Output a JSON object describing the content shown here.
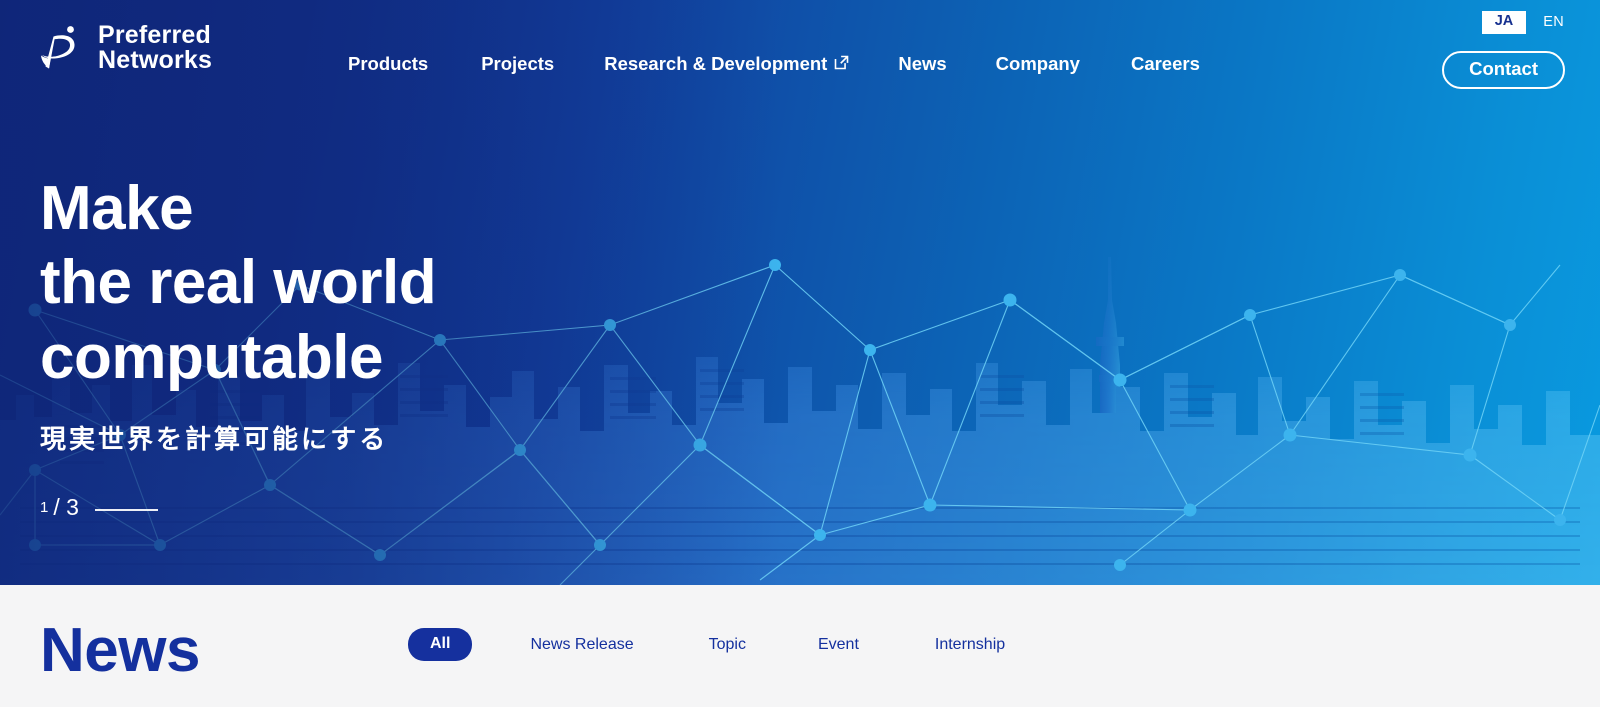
{
  "brand": {
    "logo_line1": "Preferred",
    "logo_line2": "Networks",
    "logo_icon": "preferred-networks-swoosh-logo"
  },
  "nav": {
    "items": [
      {
        "label": "Products",
        "external": false,
        "icon": ""
      },
      {
        "label": "Projects",
        "external": false,
        "icon": ""
      },
      {
        "label": "Research & Development",
        "external": true,
        "icon": "external-link-icon"
      },
      {
        "label": "News",
        "external": false,
        "icon": ""
      },
      {
        "label": "Company",
        "external": false,
        "icon": ""
      },
      {
        "label": "Careers",
        "external": false,
        "icon": ""
      }
    ],
    "contact_label": "Contact"
  },
  "language": {
    "options": [
      "JA",
      "EN"
    ],
    "ja_label": "JA",
    "en_label": "EN",
    "selected": "JA"
  },
  "hero": {
    "title": "Make\nthe real world\ncomputable",
    "subtitle": "現実世界を計算可能にする",
    "slide_current": "1",
    "slide_total": "/ 3",
    "background_image": "tokyo-skyline-network-overlay"
  },
  "news": {
    "heading": "News",
    "filters": [
      {
        "label": "All",
        "active": true
      },
      {
        "label": "News Release",
        "active": false
      },
      {
        "label": "Topic",
        "active": false
      },
      {
        "label": "Event",
        "active": false
      },
      {
        "label": "Internship",
        "active": false
      }
    ]
  },
  "colors": {
    "brand_navy": "#14309e",
    "gradient_start": "#13287f",
    "gradient_end": "#099ae0",
    "news_bg": "#f5f5f6",
    "node_cyan": "#38b6f0",
    "white": "#ffffff"
  }
}
